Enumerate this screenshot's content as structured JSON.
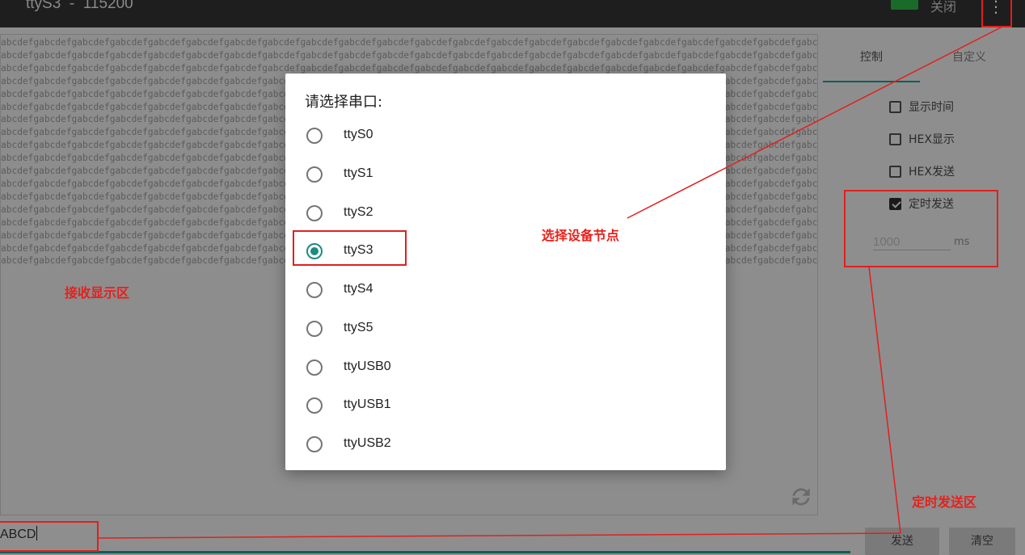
{
  "app": {
    "title": "ttyS3  -  115200",
    "close_label": "关闭",
    "menu_icon": "⋮"
  },
  "receive": {
    "line_text": "abcdefgabcdefgabcdefgabcdefgabcdefgabcdefgabcdefgabcdefgabcdefgabcdefgabcdefgabcdefgabcdefgabcdefgabcdefgabcdefgabcdefgabcdefgabcdefgabcdefgabcdefgabcdefgabcdefgabcdefgabcdefgabcdefg",
    "last_line_text": "abcdefgabcdefgabcdefgabcdefgabcdefgabcdefgabcdefgabcdefgabcdefgabcdefgabcdefgabcdefgabcdefgabcdefgabcdefgabcdefgabcdefgabcdefgabcdefgabcdefgabcdefgabcdefgabcdefgabcdefgabcdefgabcdefg",
    "full_lines": 17
  },
  "right_panel": {
    "tabs": [
      {
        "label": "控制",
        "selected": true
      },
      {
        "label": "自定义",
        "selected": false
      }
    ],
    "options": [
      {
        "label": "显示时间",
        "checked": false
      },
      {
        "label": "HEX显示",
        "checked": false
      },
      {
        "label": "HEX发送",
        "checked": false
      },
      {
        "label": "定时发送",
        "checked": true
      }
    ],
    "interval_placeholder": "1000",
    "interval_unit": "ms"
  },
  "send": {
    "input_value": "ABCD",
    "send_label": "发送",
    "clear_label": "清空"
  },
  "dialog": {
    "title": "请选择串口:",
    "ports": [
      {
        "label": "ttyS0",
        "selected": false
      },
      {
        "label": "ttyS1",
        "selected": false
      },
      {
        "label": "ttyS2",
        "selected": false
      },
      {
        "label": "ttyS3",
        "selected": true
      },
      {
        "label": "ttyS4",
        "selected": false
      },
      {
        "label": "ttyS5",
        "selected": false
      },
      {
        "label": "ttyUSB0",
        "selected": false
      },
      {
        "label": "ttyUSB1",
        "selected": false
      },
      {
        "label": "ttyUSB2",
        "selected": false
      }
    ]
  },
  "annotations": {
    "receive_area": "接收显示区",
    "select_node": "选择设备节点",
    "timed_send": "定时发送区",
    "color": "#e0201e"
  }
}
